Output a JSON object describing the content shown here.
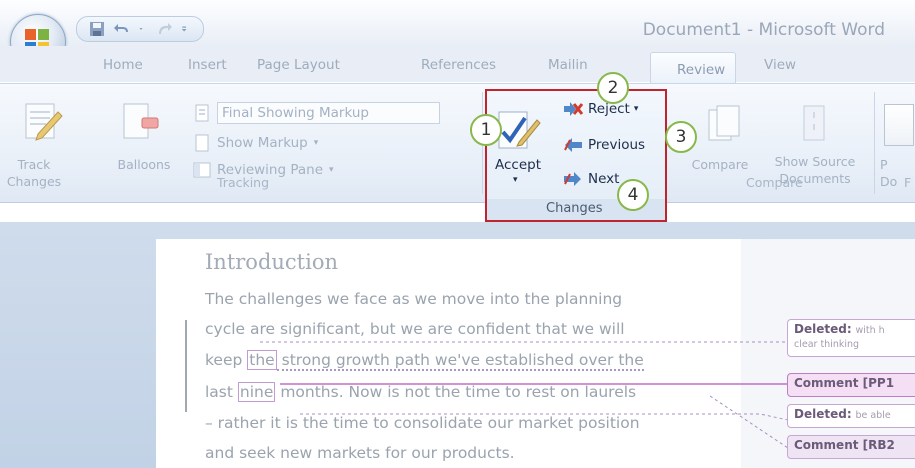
{
  "window": {
    "title": "Document1 - Microsoft Word"
  },
  "tabs": [
    "Home",
    "Insert",
    "Page Layout",
    "References",
    "Mailin",
    "Review",
    "View"
  ],
  "active_tab": "Review",
  "ribbon": {
    "tracking": {
      "track_changes": "Track\nChanges",
      "balloons": "Balloons",
      "display_for_review": "Final Showing Markup",
      "show_markup": "Show Markup",
      "reviewing_pane": "Reviewing Pane",
      "group_label": "Tracking"
    },
    "changes": {
      "accept": "Accept",
      "reject": "Reject",
      "previous": "Previous",
      "next": "Next",
      "group_label": "Changes"
    },
    "compare": {
      "compare": "Compare",
      "show_source": "Show Source\nDocuments",
      "group_label": "Compare"
    },
    "protect": {
      "label_1": "P",
      "label_2": "Do",
      "group_label": "F"
    }
  },
  "callouts": [
    "1",
    "2",
    "3",
    "4"
  ],
  "document": {
    "heading": "Introduction",
    "lines": {
      "l1": "The challenges we face as we move into the planning",
      "l2": "cycle are significant, but we are confident that we will",
      "l3_a": "keep ",
      "l3_ins": "the",
      "l3_b": " strong growth path we've established over the",
      "l4_a": "last ",
      "l4_ins": "nine",
      "l4_b": " months.  Now is not the time to rest on laurels",
      "l5": "– rather it is the time to consolidate our market position",
      "l6": "and seek new markets for our products."
    }
  },
  "balloons": [
    {
      "label": "Deleted:",
      "detail": "with h",
      "detail2": "clear thinking",
      "kind": "deleted"
    },
    {
      "label": "Comment [PP1",
      "kind": "comment"
    },
    {
      "label": "Deleted:",
      "detail": "be able",
      "kind": "deleted"
    },
    {
      "label": "Comment [RB2",
      "kind": "comment"
    }
  ],
  "colors": {
    "highlight_border": "#c0242c",
    "callout_ring": "#88b84a",
    "comment_fill": "#f5dff5"
  }
}
